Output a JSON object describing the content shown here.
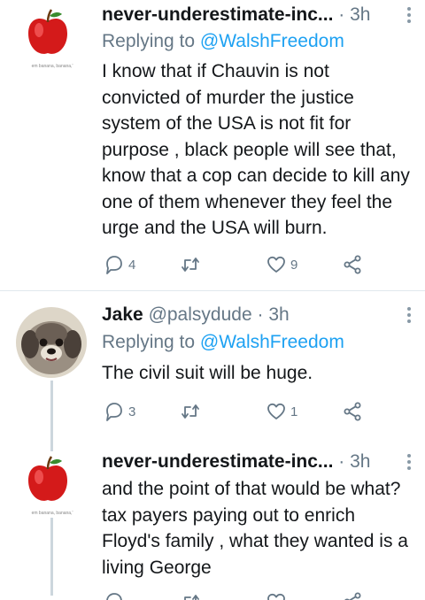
{
  "tweets": [
    {
      "name": "never-underestimate-inc...",
      "time": "3h",
      "reply_prefix": "Replying to ",
      "reply_to": "@WalshFreedom",
      "avatar_caption": "em banana, banana,'",
      "text": "I know that if Chauvin is not convicted of murder the justice system of the USA is not fit for purpose , black people will see that, know that a cop can decide to kill any one of them whenever they feel the urge and the USA will burn.",
      "reply_count": "4",
      "retweet_count": "",
      "like_count": "9"
    },
    {
      "name": "Jake",
      "handle": "@palsydude",
      "time": "3h",
      "reply_prefix": "Replying to ",
      "reply_to": "@WalshFreedom",
      "text": "The civil suit will be huge.",
      "reply_count": "3",
      "retweet_count": "",
      "like_count": "1"
    },
    {
      "name": "never-underestimate-inc...",
      "time": "3h",
      "avatar_caption": "em banana, banana,'",
      "text": "and the point of that would be what? tax payers paying out to enrich Floyd's family , what they wanted is a living George"
    }
  ],
  "separator": "·",
  "icons": {
    "reply": "reply-icon",
    "retweet": "retweet-icon",
    "like": "heart-icon",
    "share": "share-icon",
    "more": "more-vertical-icon"
  },
  "colors": {
    "link": "#1da1f2",
    "muted": "#657786",
    "text": "#14171a",
    "apple_red": "#d41a1a"
  }
}
